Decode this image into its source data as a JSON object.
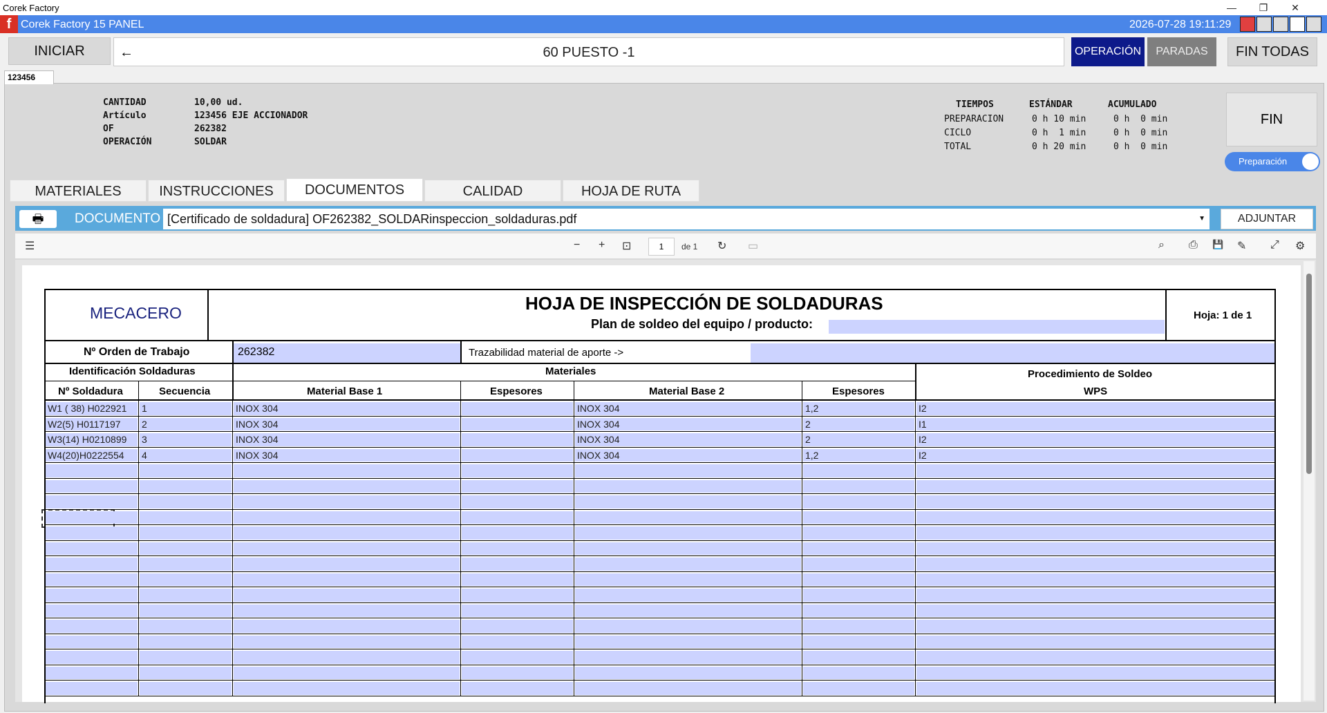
{
  "window": {
    "title": "Corek Factory",
    "minimize": "—",
    "maximize": "❐",
    "close": "✕"
  },
  "app": {
    "title": "Corek Factory 15 PANEL",
    "logo": "f",
    "datetime": "2026-07-28 19:11:29"
  },
  "header": {
    "iniciar": "INICIAR",
    "back_icon": "←",
    "station": "60 PUESTO -1",
    "operacion": "OPERACIÓN",
    "paradas": "PARADAS",
    "fin_todas": "FIN TODAS"
  },
  "order_tab": "123456",
  "order": {
    "labels": [
      "CANTIDAD",
      "Artículo",
      "OF",
      "OPERACIÓN"
    ],
    "values": [
      "10,00 ud.",
      "123456 EJE ACCIONADOR",
      "262382",
      "SOLDAR"
    ]
  },
  "times": {
    "headers": [
      "TIEMPOS",
      "ESTÁNDAR",
      "ACUMULADO"
    ],
    "rows": [
      {
        "label": "PREPARACION",
        "std": "0 h 10 min",
        "acc": "0 h  0 min"
      },
      {
        "label": "CICLO",
        "std": "0 h  1 min",
        "acc": "0 h  0 min"
      },
      {
        "label": "TOTAL",
        "std": "0 h 20 min",
        "acc": "0 h  0 min"
      }
    ]
  },
  "fin": "FIN",
  "toggle": "Preparación",
  "doc_tabs": [
    "MATERIALES",
    "INSTRUCCIONES",
    "DOCUMENTOS",
    "CALIDAD",
    "HOJA DE RUTA"
  ],
  "document": {
    "label": "DOCUMENTO",
    "selected": "[Certificado de soldadura]  OF262382_SOLDARinspeccion_soldaduras.pdf",
    "attach": "ADJUNTAR",
    "print_icon": "🖶"
  },
  "pdf_toolbar": {
    "page": "1",
    "of": "de 1",
    "icons": {
      "outline": "☰",
      "zoom_out": "−",
      "zoom_in": "+",
      "fit": "⊡",
      "rotate": "↻",
      "book": "▭",
      "search": "⌕",
      "print": "⎙",
      "save": "💾",
      "edit": "✎",
      "expand": "⤢",
      "settings": "⚙"
    }
  },
  "sheet": {
    "company": "MECACERO",
    "title": "HOJA DE INSPECCIÓN DE SOLDADURAS",
    "subtitle": "Plan de soldeo del equipo / producto:",
    "hoja": "Hoja: 1 de 1",
    "orden_label": "Nº Orden de Trabajo",
    "orden_value": "262382",
    "traz_label": "Trazabilidad material de aporte  ->",
    "ident_header": "Identificación Soldaduras",
    "materiales_header": "Materiales",
    "proc_header_1": "Procedimiento de Soldeo",
    "proc_header_2": "WPS",
    "columns": [
      "Nº Soldadura",
      "Secuencia",
      "Material Base 1",
      "Espesores",
      "Material Base 2",
      "Espesores"
    ],
    "rows": [
      [
        "W1 ( 38) H022921",
        "1",
        "INOX 304",
        "",
        "INOX 304",
        "1,2",
        "I2"
      ],
      [
        "W2(5) H0117197",
        "2",
        "INOX 304",
        "",
        "INOX 304",
        "2",
        "I1"
      ],
      [
        "W3(14) H0210899",
        "3",
        "INOX 304",
        "",
        "INOX 304",
        "2",
        "I2"
      ],
      [
        "W4(20)H0222554",
        "4",
        "INOX 304",
        "",
        "INOX 304",
        "1,2",
        "I2"
      ]
    ]
  }
}
